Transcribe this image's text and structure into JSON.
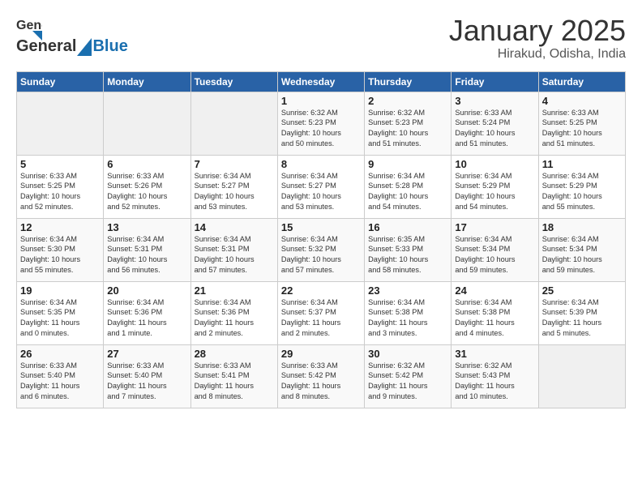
{
  "header": {
    "logo_general": "General",
    "logo_blue": "Blue",
    "month": "January 2025",
    "location": "Hirakud, Odisha, India"
  },
  "weekdays": [
    "Sunday",
    "Monday",
    "Tuesday",
    "Wednesday",
    "Thursday",
    "Friday",
    "Saturday"
  ],
  "weeks": [
    [
      {
        "day": "",
        "info": ""
      },
      {
        "day": "",
        "info": ""
      },
      {
        "day": "",
        "info": ""
      },
      {
        "day": "1",
        "info": "Sunrise: 6:32 AM\nSunset: 5:23 PM\nDaylight: 10 hours\nand 50 minutes."
      },
      {
        "day": "2",
        "info": "Sunrise: 6:32 AM\nSunset: 5:23 PM\nDaylight: 10 hours\nand 51 minutes."
      },
      {
        "day": "3",
        "info": "Sunrise: 6:33 AM\nSunset: 5:24 PM\nDaylight: 10 hours\nand 51 minutes."
      },
      {
        "day": "4",
        "info": "Sunrise: 6:33 AM\nSunset: 5:25 PM\nDaylight: 10 hours\nand 51 minutes."
      }
    ],
    [
      {
        "day": "5",
        "info": "Sunrise: 6:33 AM\nSunset: 5:25 PM\nDaylight: 10 hours\nand 52 minutes."
      },
      {
        "day": "6",
        "info": "Sunrise: 6:33 AM\nSunset: 5:26 PM\nDaylight: 10 hours\nand 52 minutes."
      },
      {
        "day": "7",
        "info": "Sunrise: 6:34 AM\nSunset: 5:27 PM\nDaylight: 10 hours\nand 53 minutes."
      },
      {
        "day": "8",
        "info": "Sunrise: 6:34 AM\nSunset: 5:27 PM\nDaylight: 10 hours\nand 53 minutes."
      },
      {
        "day": "9",
        "info": "Sunrise: 6:34 AM\nSunset: 5:28 PM\nDaylight: 10 hours\nand 54 minutes."
      },
      {
        "day": "10",
        "info": "Sunrise: 6:34 AM\nSunset: 5:29 PM\nDaylight: 10 hours\nand 54 minutes."
      },
      {
        "day": "11",
        "info": "Sunrise: 6:34 AM\nSunset: 5:29 PM\nDaylight: 10 hours\nand 55 minutes."
      }
    ],
    [
      {
        "day": "12",
        "info": "Sunrise: 6:34 AM\nSunset: 5:30 PM\nDaylight: 10 hours\nand 55 minutes."
      },
      {
        "day": "13",
        "info": "Sunrise: 6:34 AM\nSunset: 5:31 PM\nDaylight: 10 hours\nand 56 minutes."
      },
      {
        "day": "14",
        "info": "Sunrise: 6:34 AM\nSunset: 5:31 PM\nDaylight: 10 hours\nand 57 minutes."
      },
      {
        "day": "15",
        "info": "Sunrise: 6:34 AM\nSunset: 5:32 PM\nDaylight: 10 hours\nand 57 minutes."
      },
      {
        "day": "16",
        "info": "Sunrise: 6:35 AM\nSunset: 5:33 PM\nDaylight: 10 hours\nand 58 minutes."
      },
      {
        "day": "17",
        "info": "Sunrise: 6:34 AM\nSunset: 5:34 PM\nDaylight: 10 hours\nand 59 minutes."
      },
      {
        "day": "18",
        "info": "Sunrise: 6:34 AM\nSunset: 5:34 PM\nDaylight: 10 hours\nand 59 minutes."
      }
    ],
    [
      {
        "day": "19",
        "info": "Sunrise: 6:34 AM\nSunset: 5:35 PM\nDaylight: 11 hours\nand 0 minutes."
      },
      {
        "day": "20",
        "info": "Sunrise: 6:34 AM\nSunset: 5:36 PM\nDaylight: 11 hours\nand 1 minute."
      },
      {
        "day": "21",
        "info": "Sunrise: 6:34 AM\nSunset: 5:36 PM\nDaylight: 11 hours\nand 2 minutes."
      },
      {
        "day": "22",
        "info": "Sunrise: 6:34 AM\nSunset: 5:37 PM\nDaylight: 11 hours\nand 2 minutes."
      },
      {
        "day": "23",
        "info": "Sunrise: 6:34 AM\nSunset: 5:38 PM\nDaylight: 11 hours\nand 3 minutes."
      },
      {
        "day": "24",
        "info": "Sunrise: 6:34 AM\nSunset: 5:38 PM\nDaylight: 11 hours\nand 4 minutes."
      },
      {
        "day": "25",
        "info": "Sunrise: 6:34 AM\nSunset: 5:39 PM\nDaylight: 11 hours\nand 5 minutes."
      }
    ],
    [
      {
        "day": "26",
        "info": "Sunrise: 6:33 AM\nSunset: 5:40 PM\nDaylight: 11 hours\nand 6 minutes."
      },
      {
        "day": "27",
        "info": "Sunrise: 6:33 AM\nSunset: 5:40 PM\nDaylight: 11 hours\nand 7 minutes."
      },
      {
        "day": "28",
        "info": "Sunrise: 6:33 AM\nSunset: 5:41 PM\nDaylight: 11 hours\nand 8 minutes."
      },
      {
        "day": "29",
        "info": "Sunrise: 6:33 AM\nSunset: 5:42 PM\nDaylight: 11 hours\nand 8 minutes."
      },
      {
        "day": "30",
        "info": "Sunrise: 6:32 AM\nSunset: 5:42 PM\nDaylight: 11 hours\nand 9 minutes."
      },
      {
        "day": "31",
        "info": "Sunrise: 6:32 AM\nSunset: 5:43 PM\nDaylight: 11 hours\nand 10 minutes."
      },
      {
        "day": "",
        "info": ""
      }
    ]
  ]
}
